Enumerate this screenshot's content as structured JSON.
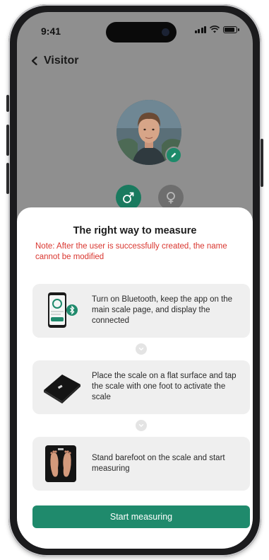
{
  "status_bar": {
    "time": "9:41"
  },
  "header": {
    "back_label": "Visitor"
  },
  "profile": {
    "avatar_icon": "person-photo",
    "edit_icon": "pencil-icon",
    "gender_options": [
      {
        "icon": "male-symbol-icon",
        "selected": true
      },
      {
        "icon": "female-symbol-icon",
        "selected": false
      }
    ]
  },
  "sheet": {
    "title": "The right way to measure",
    "note": "Note: After the user is successfully created, the name cannot be modified",
    "steps": [
      {
        "text": "Turn on Bluetooth, keep the app on the main scale page, and display the connected",
        "icon": "phone-bluetooth-icon"
      },
      {
        "text": "Place the scale on a flat surface and tap the scale with one foot to activate the scale",
        "icon": "scale-icon"
      },
      {
        "text": "Stand barefoot on the scale and start measuring",
        "icon": "barefoot-scale-icon"
      }
    ],
    "start_button": "Start measuring"
  },
  "colors": {
    "accent": "#1f8a6c",
    "note": "#d9362f",
    "overlay": "#8f8f8f"
  }
}
